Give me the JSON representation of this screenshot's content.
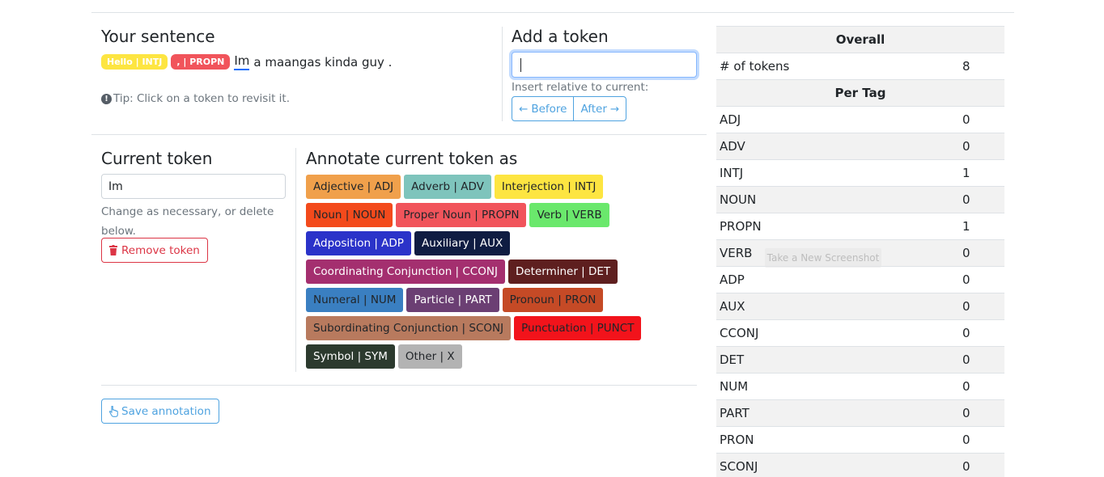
{
  "sentence": {
    "title": "Your sentence",
    "tokens": [
      {
        "label": "Hello | INTJ",
        "color": "#fde541"
      },
      {
        "label": ", | PROPN",
        "color": "#f1545b"
      }
    ],
    "current_token_text": "Im",
    "rest_text": "a maangas kinda guy .",
    "tip": "Tip: Click on a token to revisit it."
  },
  "add_token": {
    "title": "Add a token",
    "input_value": "",
    "insert_label": "Insert relative to current:",
    "before_label": "Before",
    "after_label": "After"
  },
  "current_token": {
    "title": "Current token",
    "value": "Im",
    "hint": "Change as necessary, or delete below.",
    "remove_label": "Remove token"
  },
  "annotate": {
    "title": "Annotate current token as",
    "tags": [
      {
        "label": "Adjective | ADJ",
        "bg": "#f0a04b",
        "fg": "#212529"
      },
      {
        "label": "Adverb | ADV",
        "bg": "#7ec4bc",
        "fg": "#212529"
      },
      {
        "label": "Interjection | INTJ",
        "bg": "#fde541",
        "fg": "#212529"
      },
      {
        "label": "Noun | NOUN",
        "bg": "#f34a1c",
        "fg": "#212529"
      },
      {
        "label": "Proper Noun | PROPN",
        "bg": "#f1545b",
        "fg": "#212529"
      },
      {
        "label": "Verb | VERB",
        "bg": "#6ae86c",
        "fg": "#212529"
      },
      {
        "label": "Adposition | ADP",
        "bg": "#2b33c9",
        "fg": "#ffffff"
      },
      {
        "label": "Auxiliary | AUX",
        "bg": "#0f1c42",
        "fg": "#ffffff"
      },
      {
        "label": "Coordinating Conjunction | CCONJ",
        "bg": "#a42f6f",
        "fg": "#ffffff"
      },
      {
        "label": "Determiner | DET",
        "bg": "#5e1f1f",
        "fg": "#ffffff"
      },
      {
        "label": "Numeral | NUM",
        "bg": "#3a7fc1",
        "fg": "#212529"
      },
      {
        "label": "Particle | PART",
        "bg": "#6b3f73",
        "fg": "#ffffff"
      },
      {
        "label": "Pronoun | PRON",
        "bg": "#c54a26",
        "fg": "#212529"
      },
      {
        "label": "Subordinating Conjunction | SCONJ",
        "bg": "#b87a5e",
        "fg": "#212529"
      },
      {
        "label": "Punctuation | PUNCT",
        "bg": "#f2131b",
        "fg": "#212529"
      },
      {
        "label": "Symbol | SYM",
        "bg": "#2c3a2e",
        "fg": "#ffffff"
      },
      {
        "label": "Other | X",
        "bg": "#b3b3b3",
        "fg": "#212529"
      }
    ],
    "save_label": "Save annotation"
  },
  "stats": {
    "overall_header": "Overall",
    "tokens_label": "# of tokens",
    "tokens_value": "8",
    "per_tag_header": "Per Tag",
    "rows": [
      {
        "tag": "ADJ",
        "count": "0"
      },
      {
        "tag": "ADV",
        "count": "0"
      },
      {
        "tag": "INTJ",
        "count": "1"
      },
      {
        "tag": "NOUN",
        "count": "0"
      },
      {
        "tag": "PROPN",
        "count": "1"
      },
      {
        "tag": "VERB",
        "count": "0"
      },
      {
        "tag": "ADP",
        "count": "0"
      },
      {
        "tag": "AUX",
        "count": "0"
      },
      {
        "tag": "CCONJ",
        "count": "0"
      },
      {
        "tag": "DET",
        "count": "0"
      },
      {
        "tag": "NUM",
        "count": "0"
      },
      {
        "tag": "PART",
        "count": "0"
      },
      {
        "tag": "PRON",
        "count": "0"
      },
      {
        "tag": "SCONJ",
        "count": "0"
      }
    ]
  },
  "overlay": {
    "screenshot_hint": "Take a New Screenshot"
  }
}
